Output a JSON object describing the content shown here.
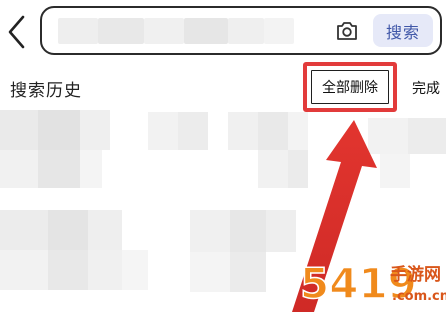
{
  "header": {
    "search_placeholder": "",
    "search_button_label": "搜索",
    "camera_icon": "camera-icon",
    "back_icon": "chevron-left-icon"
  },
  "history": {
    "title": "搜索历史",
    "delete_all_label": "全部删除",
    "done_label": "完成"
  },
  "annotation": {
    "highlight_color": "#e23b3b",
    "arrow_color": "#e23b3b"
  },
  "watermark": {
    "brand_text": "5419",
    "site_text": "手游网",
    "domain_text": ".com.cn"
  },
  "colors": {
    "accent_bg": "#e6e9f8",
    "accent_text": "#3f56a8",
    "border": "#2b2b2b"
  }
}
